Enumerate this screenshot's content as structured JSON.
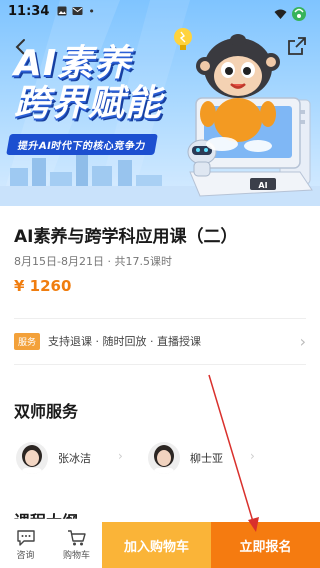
{
  "status_bar": {
    "time": "11:34"
  },
  "banner": {
    "title_line1": "AI素养",
    "title_line2": "跨界赋能",
    "subtitle": "提升AI时代下的核心竞争力",
    "computer_label": "AI"
  },
  "course": {
    "title": "AI素养与跨学科应用课（二）",
    "meta": "8月15日-8月21日 · 共17.5课时",
    "price": "¥ 1260"
  },
  "service": {
    "badge": "服务",
    "text": "支持退课 · 随时回放 · 直播授课"
  },
  "teachers_section": {
    "title": "双师服务",
    "teachers": [
      {
        "name": "张冰洁"
      },
      {
        "name": "柳士亚"
      }
    ]
  },
  "next_section": {
    "title": "课程大纲"
  },
  "bottom_bar": {
    "consult_label": "咨询",
    "cart_label": "购物车",
    "add_to_cart": "加入购物车",
    "enroll_now": "立即报名"
  },
  "colors": {
    "accent_orange": "#f57b10",
    "cart_yellow": "#fab438",
    "price": "#f07d0f",
    "badge": "#f3a13a",
    "annotation_red": "#d9302c"
  }
}
